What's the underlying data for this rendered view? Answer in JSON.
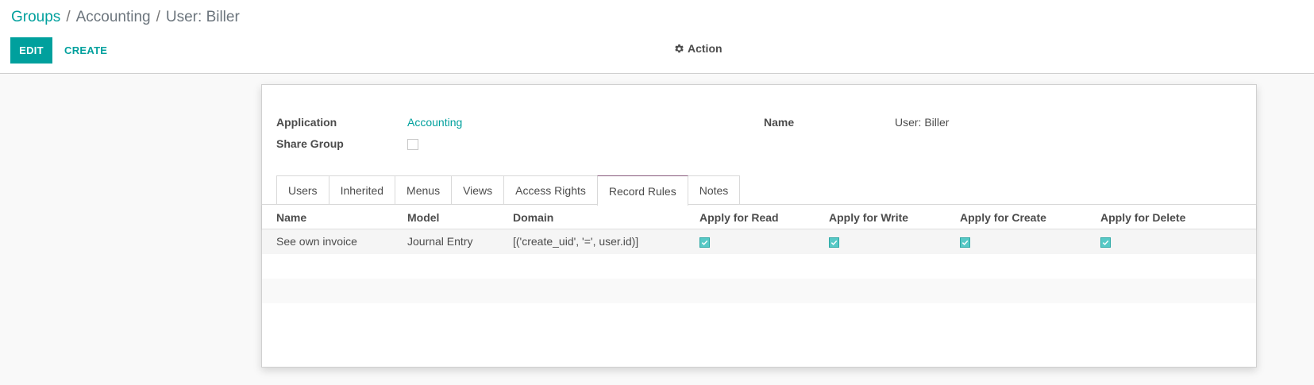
{
  "breadcrumb": {
    "root": "Groups",
    "separator1": "/",
    "middle": "Accounting",
    "separator2": "/",
    "current": "User: Biller"
  },
  "buttons": {
    "edit": "EDIT",
    "create": "CREATE",
    "action": "Action"
  },
  "form": {
    "application_label": "Application",
    "application_value": "Accounting",
    "share_group_label": "Share Group",
    "share_group_checked": false,
    "name_label": "Name",
    "name_value": "User: Biller"
  },
  "tabs": [
    "Users",
    "Inherited",
    "Menus",
    "Views",
    "Access Rights",
    "Record Rules",
    "Notes"
  ],
  "active_tab": "Record Rules",
  "table": {
    "headers": [
      "Name",
      "Model",
      "Domain",
      "Apply for Read",
      "Apply for Write",
      "Apply for Create",
      "Apply for Delete"
    ],
    "rows": [
      {
        "name": "See own invoice",
        "model": "Journal Entry",
        "domain": "[('create_uid', '=', user.id)]",
        "read": true,
        "write": true,
        "create": true,
        "delete": true
      }
    ]
  },
  "colors": {
    "accent": "#00a09d",
    "active_tab_border": "#875a7b",
    "checkbox_fill": "#58c9c6"
  }
}
